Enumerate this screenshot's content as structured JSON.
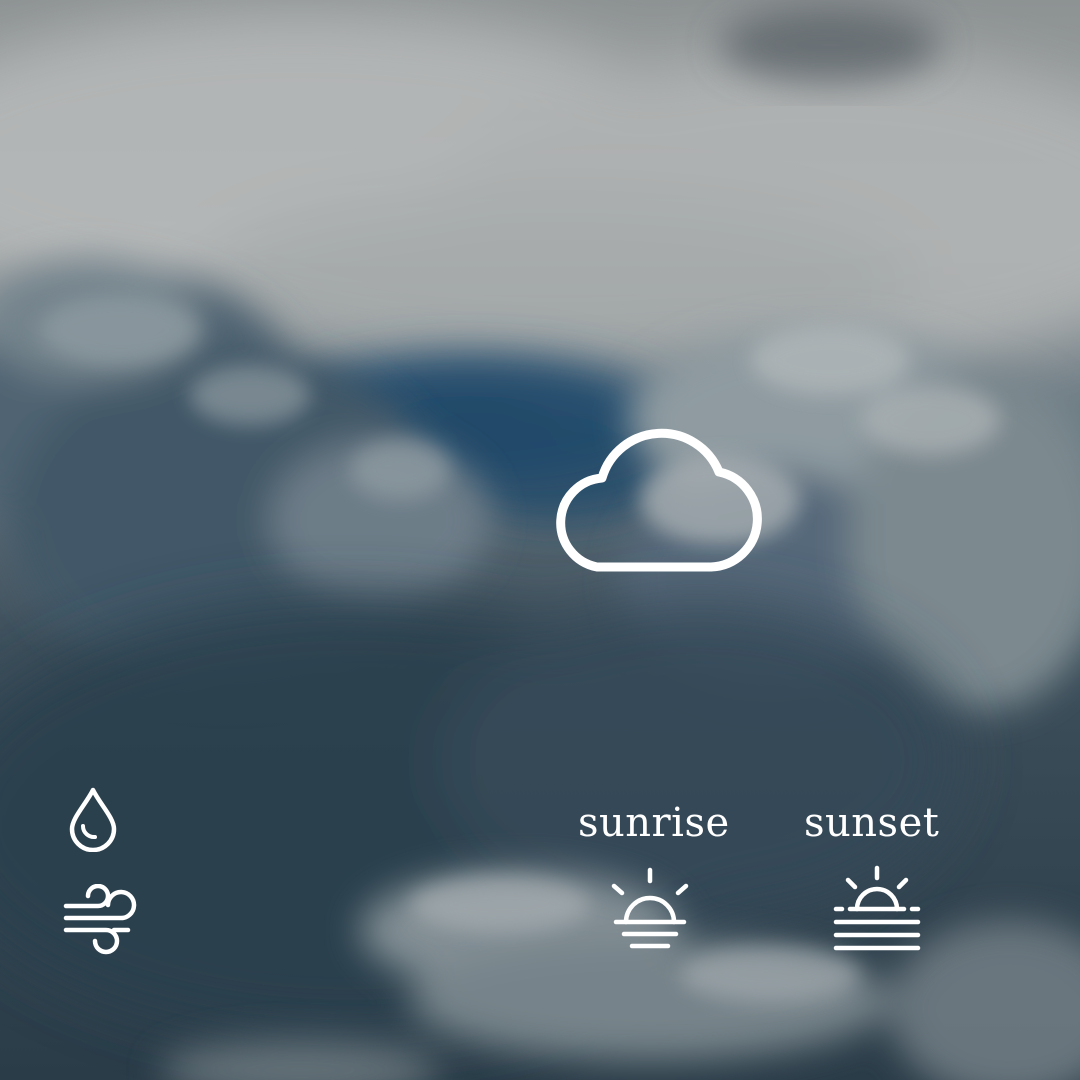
{
  "colors": {
    "icon_stroke": "#ffffff",
    "text": "#ffffff",
    "sky_dark": "#2c3f4c",
    "sky_light": "#a7abab",
    "sky_blue_gap": "#274e6c"
  },
  "weather": {
    "condition_icon": "cloud-icon",
    "humidity_icon": "water-drop-icon",
    "wind_icon": "wind-icon"
  },
  "sun": {
    "sunrise_label": "sunrise",
    "sunrise_icon": "sunrise-icon",
    "sunset_label": "sunset",
    "sunset_icon": "sunset-icon"
  }
}
